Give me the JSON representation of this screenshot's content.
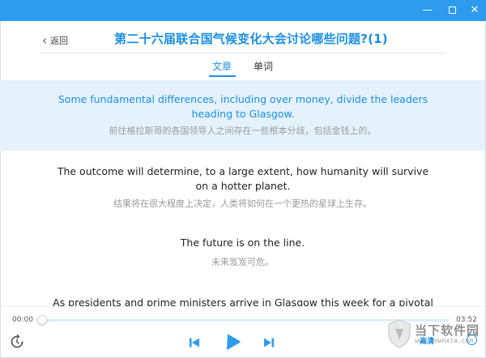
{
  "window": {
    "minimize_glyph": "—",
    "close_glyph": "✕"
  },
  "header": {
    "back_label": "返回",
    "title": "第二十六届联合国气候变化大会讨论哪些问题?(1)"
  },
  "tabs": [
    {
      "label": "文章",
      "active": true
    },
    {
      "label": "单词",
      "active": false
    }
  ],
  "paragraphs": [
    {
      "en": "Some fundamental differences, including over money, divide the leaders heading to Glasgow.",
      "zh": "前往格拉斯哥的各国领导人之间存在一些根本分歧，包括金钱上的。",
      "active": true
    },
    {
      "en": "The outcome will determine, to a large extent, how humanity will survive on a hotter planet.",
      "zh": "结果将在很大程度上决定，人类将如何在一个更热的星球上生存。",
      "active": false
    },
    {
      "en": "The future is on the line.",
      "zh": "未来岌岌可危。",
      "active": false
    },
    {
      "en": "As presidents and prime ministers arrive in Glasgow this week for a pivotal climate",
      "zh": "",
      "active": false
    }
  ],
  "player": {
    "current_time": "00:00",
    "total_time": "03:52",
    "progress_fraction": 0.0
  },
  "watermark": {
    "site_name": "当下软件园",
    "site_url": "www.downxia.com",
    "badge": "高清"
  },
  "colors": {
    "accent": "#1a8fe3",
    "titlebar": "#2e9bef",
    "active_paragraph_bg": "#e5f2fc"
  },
  "icons": [
    "minimize-icon",
    "maximize-icon",
    "close-icon",
    "back-chevron-icon",
    "loop-icon",
    "previous-icon",
    "play-icon",
    "next-icon"
  ]
}
